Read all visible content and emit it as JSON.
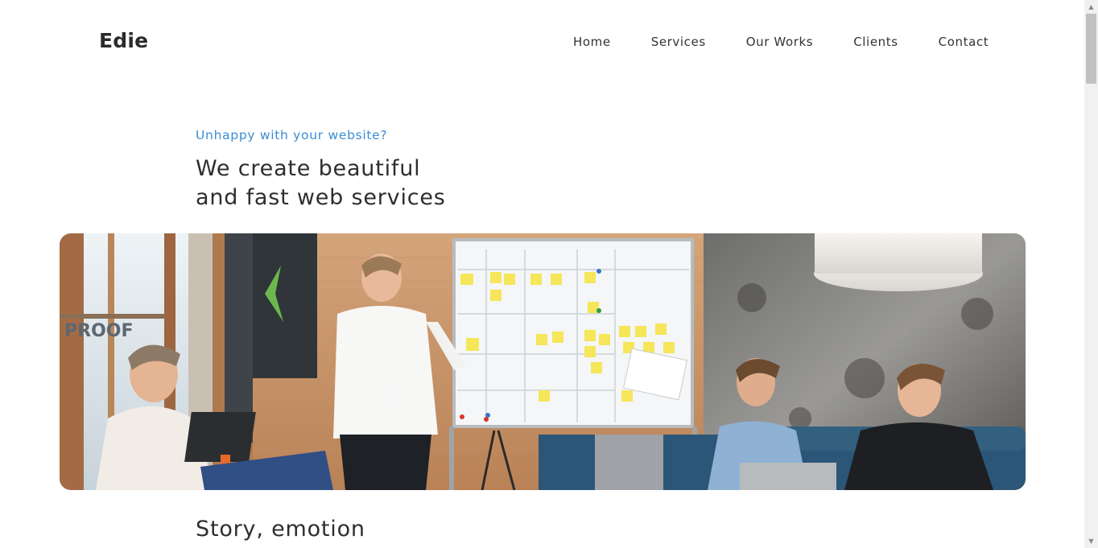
{
  "header": {
    "logo": "Edie",
    "nav": [
      {
        "label": "Home"
      },
      {
        "label": "Services"
      },
      {
        "label": "Our Works"
      },
      {
        "label": "Clients"
      },
      {
        "label": "Contact"
      }
    ]
  },
  "hero": {
    "eyebrow": "Unhappy with your website?",
    "headline_line1": "We create beautiful",
    "headline_line2": "and fast web services",
    "image_alt": "team-meeting-photo"
  },
  "section": {
    "title": "Story, emotion"
  },
  "colors": {
    "accent": "#3a8dd3",
    "text": "#2e2e2e",
    "background": "#ffffff"
  },
  "scrollbar": {
    "up_icon": "chevron-up-icon",
    "down_icon": "chevron-down-icon"
  }
}
